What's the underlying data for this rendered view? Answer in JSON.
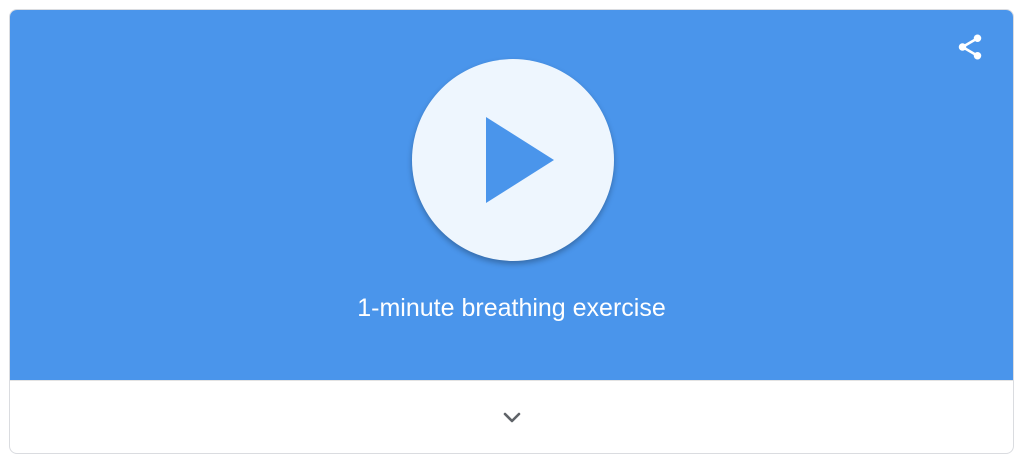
{
  "card": {
    "title": "1-minute breathing exercise",
    "icons": {
      "share": "share-icon",
      "play": "play-icon",
      "expand": "chevron-down-icon"
    },
    "colors": {
      "hero_background": "#4a95eb",
      "play_circle": "#eef6fe",
      "play_triangle": "#4a95eb",
      "title_text": "#ffffff",
      "chevron": "#5f6368"
    }
  }
}
